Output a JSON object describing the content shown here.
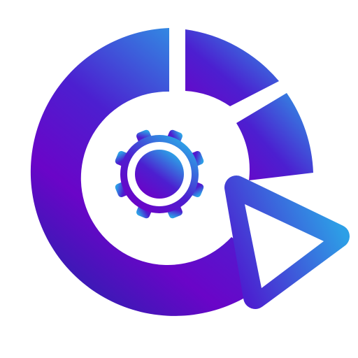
{
  "logo": {
    "icon_name": "gear-dashboard-cursor-logo",
    "parts": {
      "ring": "donut-ring",
      "chart_segments": "pie-chart-segments",
      "gear": "gear-icon",
      "cursor": "cursor-arrow-icon"
    },
    "colors": {
      "background": "#ffffff",
      "gradient_light": "#2d9fe6",
      "gradient_mid": "#4c1fd0",
      "gradient_deep": "#6a05c8",
      "gradient_dark": "#3a1ab5",
      "cutout": "#ffffff"
    }
  }
}
